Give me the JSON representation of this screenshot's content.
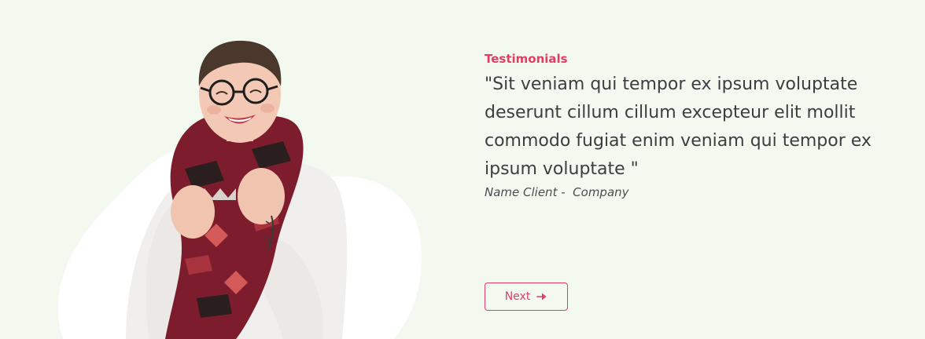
{
  "testimonials": {
    "eyebrow": "Testimonials",
    "quote": "\"Sit veniam qui tempor ex ipsum voluptate deserunt cillum cillum excepteur elit mollit commodo fugiat enim veniam qui tempor ex ipsum voluptate \"",
    "attribution": "Name Client -  Company",
    "next_label": "Next",
    "next_icon": "arrow-right-icon"
  },
  "colors": {
    "background": "#f4f9ef",
    "accent": "#e23d63",
    "text": "#3b3e40",
    "blob": "#ffffff"
  }
}
